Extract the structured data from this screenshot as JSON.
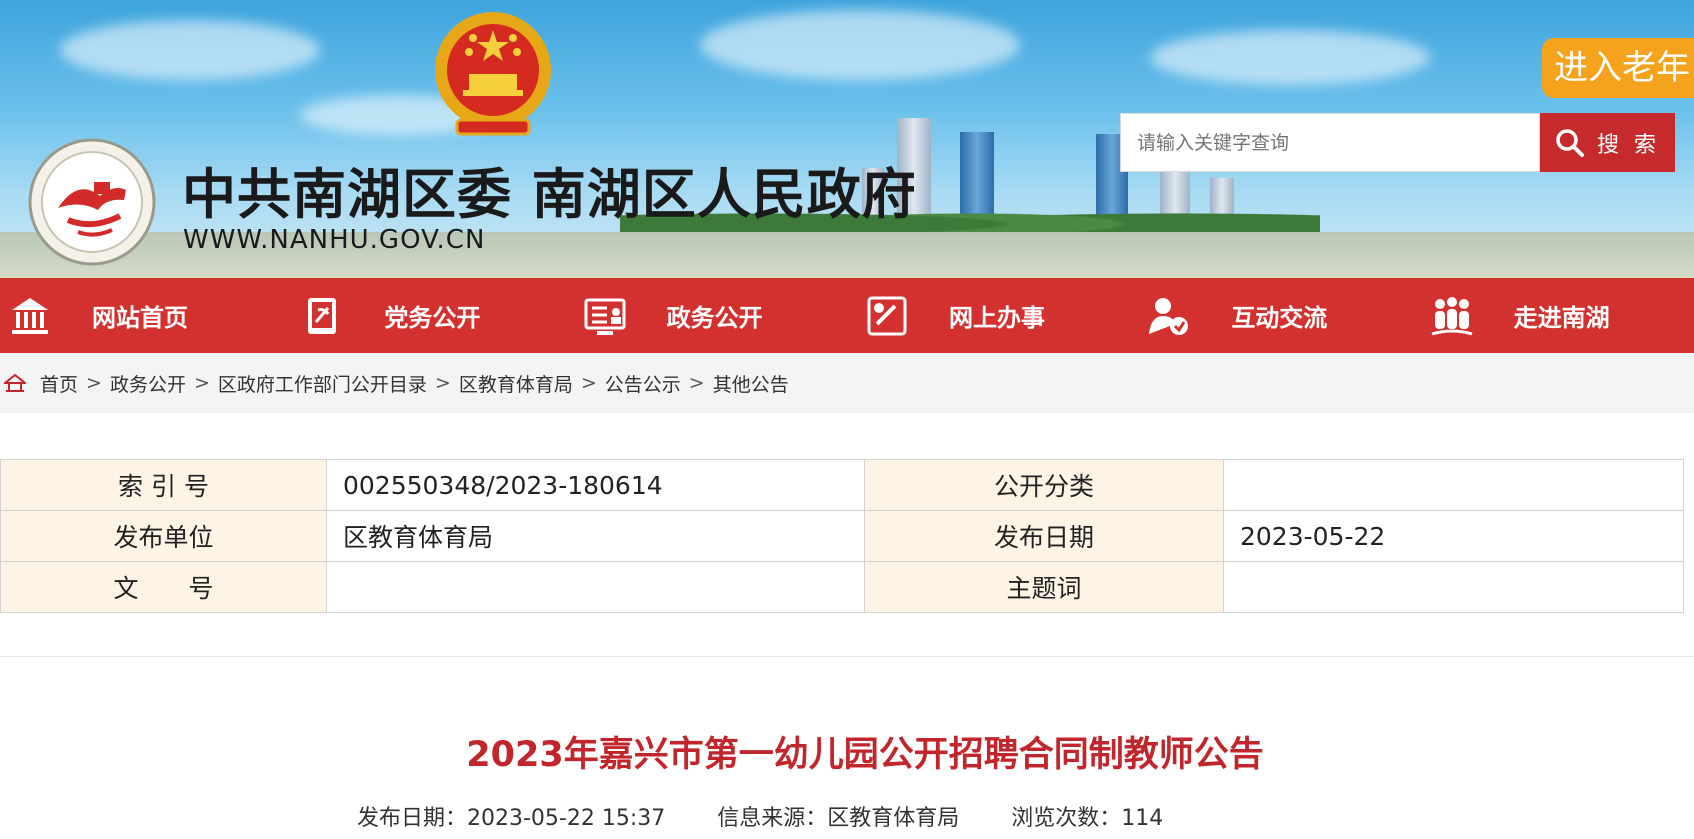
{
  "header": {
    "site_title": "中共南湖区委 南湖区人民政府",
    "site_url": "WWW.NANHU.GOV.CN",
    "elder_mode_label": "进入老年",
    "search_placeholder": "请输入关键字查询",
    "search_button_label": "搜 索",
    "brand_red": "#d3312f",
    "accent_orange": "#f5a21d"
  },
  "nav": {
    "items": [
      {
        "label": "网站首页",
        "icon": "home-icon"
      },
      {
        "label": "党务公开",
        "icon": "party-icon"
      },
      {
        "label": "政务公开",
        "icon": "gov-info-icon"
      },
      {
        "label": "网上办事",
        "icon": "online-service-icon"
      },
      {
        "label": "互动交流",
        "icon": "interaction-icon"
      },
      {
        "label": "走进南湖",
        "icon": "people-icon"
      }
    ]
  },
  "breadcrumb": {
    "items": [
      "首页",
      "政务公开",
      "区政府工作部门公开目录",
      "区教育体育局",
      "公告公示",
      "其他公告"
    ],
    "separator": ">"
  },
  "meta": {
    "index_label": "索 引 号",
    "index_value": "002550348/2023-180614",
    "category_label": "公开分类",
    "category_value": "",
    "publisher_label": "发布单位",
    "publisher_value": "区教育体育局",
    "date_label": "发布日期",
    "date_value": "2023-05-22",
    "docno_label": "文　　号",
    "docno_value": "",
    "keyword_label": "主题词",
    "keyword_value": ""
  },
  "article": {
    "title": "2023年嘉兴市第一幼儿园公开招聘合同制教师公告",
    "publish_date": "发布日期：2023-05-22 15:37",
    "source": "信息来源：区教育体育局",
    "views": "浏览次数：114"
  }
}
